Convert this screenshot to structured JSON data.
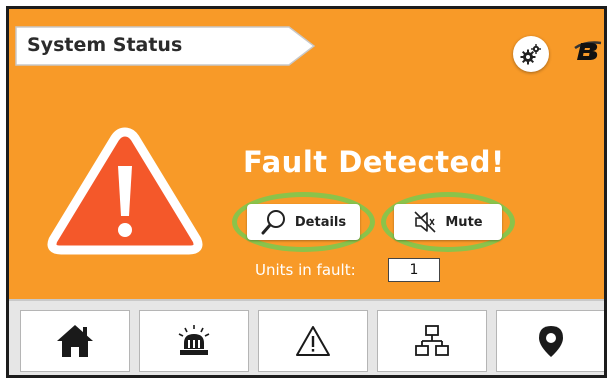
{
  "header": {
    "title": "System Status"
  },
  "alert": {
    "title": "Fault Detected!",
    "details_label": "Details",
    "mute_label": "Mute",
    "units_label": "Units in fault:",
    "units_value": "1"
  },
  "icons": {
    "settings": "gears-icon",
    "brand": "brand-logo",
    "alert": "warning-triangle-icon",
    "details": "magnifier-icon",
    "mute": "speaker-muted-icon"
  },
  "nav": [
    {
      "name": "nav-home",
      "icon": "home-icon"
    },
    {
      "name": "nav-alarm",
      "icon": "alarm-siren-icon"
    },
    {
      "name": "nav-warnings",
      "icon": "warning-icon"
    },
    {
      "name": "nav-network",
      "icon": "network-icon"
    },
    {
      "name": "nav-location",
      "icon": "location-pin-icon"
    }
  ],
  "colors": {
    "background": "#f89a28",
    "alert_triangle": "#f4582a",
    "highlight": "#8bc34a",
    "nav_bar": "#e6e6e6"
  }
}
